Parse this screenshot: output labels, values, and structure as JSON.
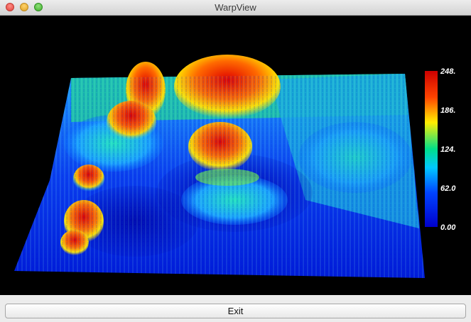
{
  "window": {
    "title": "WarpView"
  },
  "colorbar": {
    "labels": [
      "248.",
      "186.",
      "124.",
      "62.0",
      "0.00"
    ],
    "gradient_colors": [
      "#cc0000",
      "#ff6600",
      "#ffee00",
      "#00e08a",
      "#00c8ff",
      "#0044ff",
      "#0000cc"
    ]
  },
  "buttons": {
    "exit_label": "Exit"
  }
}
